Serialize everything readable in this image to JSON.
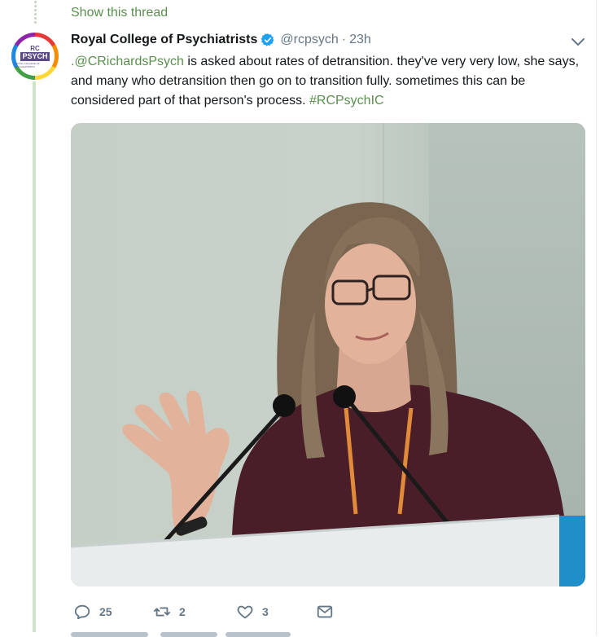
{
  "thread": {
    "show_label": "Show this thread"
  },
  "tweet": {
    "avatar": {
      "line1": "RC",
      "line2": "PSYCH",
      "line3": "ROYAL COLLEGE OF PSYCHIATRISTS"
    },
    "display_name": "Royal College of Psychiatrists",
    "verified_icon": "verified-badge-icon",
    "handle": "@rcpsych",
    "separator": "·",
    "time": "23h",
    "text": {
      "mention": ".@CRichardsPsych",
      "body": " is asked about rates of detransition. they've very very low, she says, and many who detransition then go on to transition fully. sometimes this can be considered part of that person's process. ",
      "hashtag": "#RCPsychIC"
    },
    "photo": {
      "alt": "Speaker at a podium with microphones, gesturing with raised hand"
    },
    "actions": {
      "reply_count": "25",
      "retweet_count": "2",
      "like_count": "3"
    }
  },
  "colors": {
    "accent": "#5a8f4e",
    "muted": "#657786",
    "verified": "#1da1f2"
  }
}
